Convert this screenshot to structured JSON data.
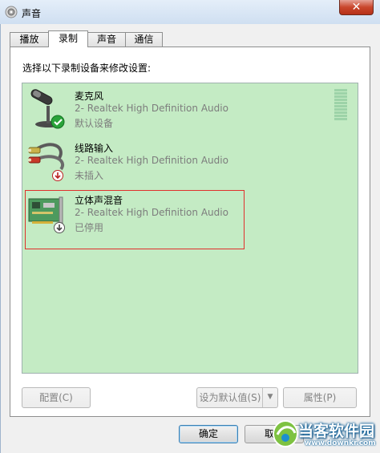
{
  "window": {
    "title": "声音",
    "close_label": "✕",
    "icon": "speaker-icon"
  },
  "tabs": [
    {
      "label": "播放",
      "active": false
    },
    {
      "label": "录制",
      "active": true
    },
    {
      "label": "声音",
      "active": false
    },
    {
      "label": "通信",
      "active": false
    }
  ],
  "instruction": "选择以下录制设备来修改设置:",
  "devices": [
    {
      "name": "麦克风",
      "description": "2- Realtek High Definition Audio",
      "status": "默认设备",
      "icon": "microphone-icon",
      "badge": "check-icon"
    },
    {
      "name": "线路输入",
      "description": "2- Realtek High Definition Audio",
      "status": "未插入",
      "icon": "line-in-cable-icon",
      "badge": "unplugged-icon"
    },
    {
      "name": "立体声混音",
      "description": "2- Realtek High Definition Audio",
      "status": "已停用",
      "icon": "sound-card-icon",
      "badge": "disabled-icon"
    }
  ],
  "buttons": {
    "configure": "配置(C)",
    "set_default": "设为默认值(S)",
    "properties": "属性(P)",
    "ok": "确定",
    "cancel": "取消"
  },
  "watermark": {
    "brand": "当客软件园",
    "url": "www.downkr.com"
  },
  "colors": {
    "list_background": "#c4ebc4",
    "highlight": "#e0302c"
  }
}
